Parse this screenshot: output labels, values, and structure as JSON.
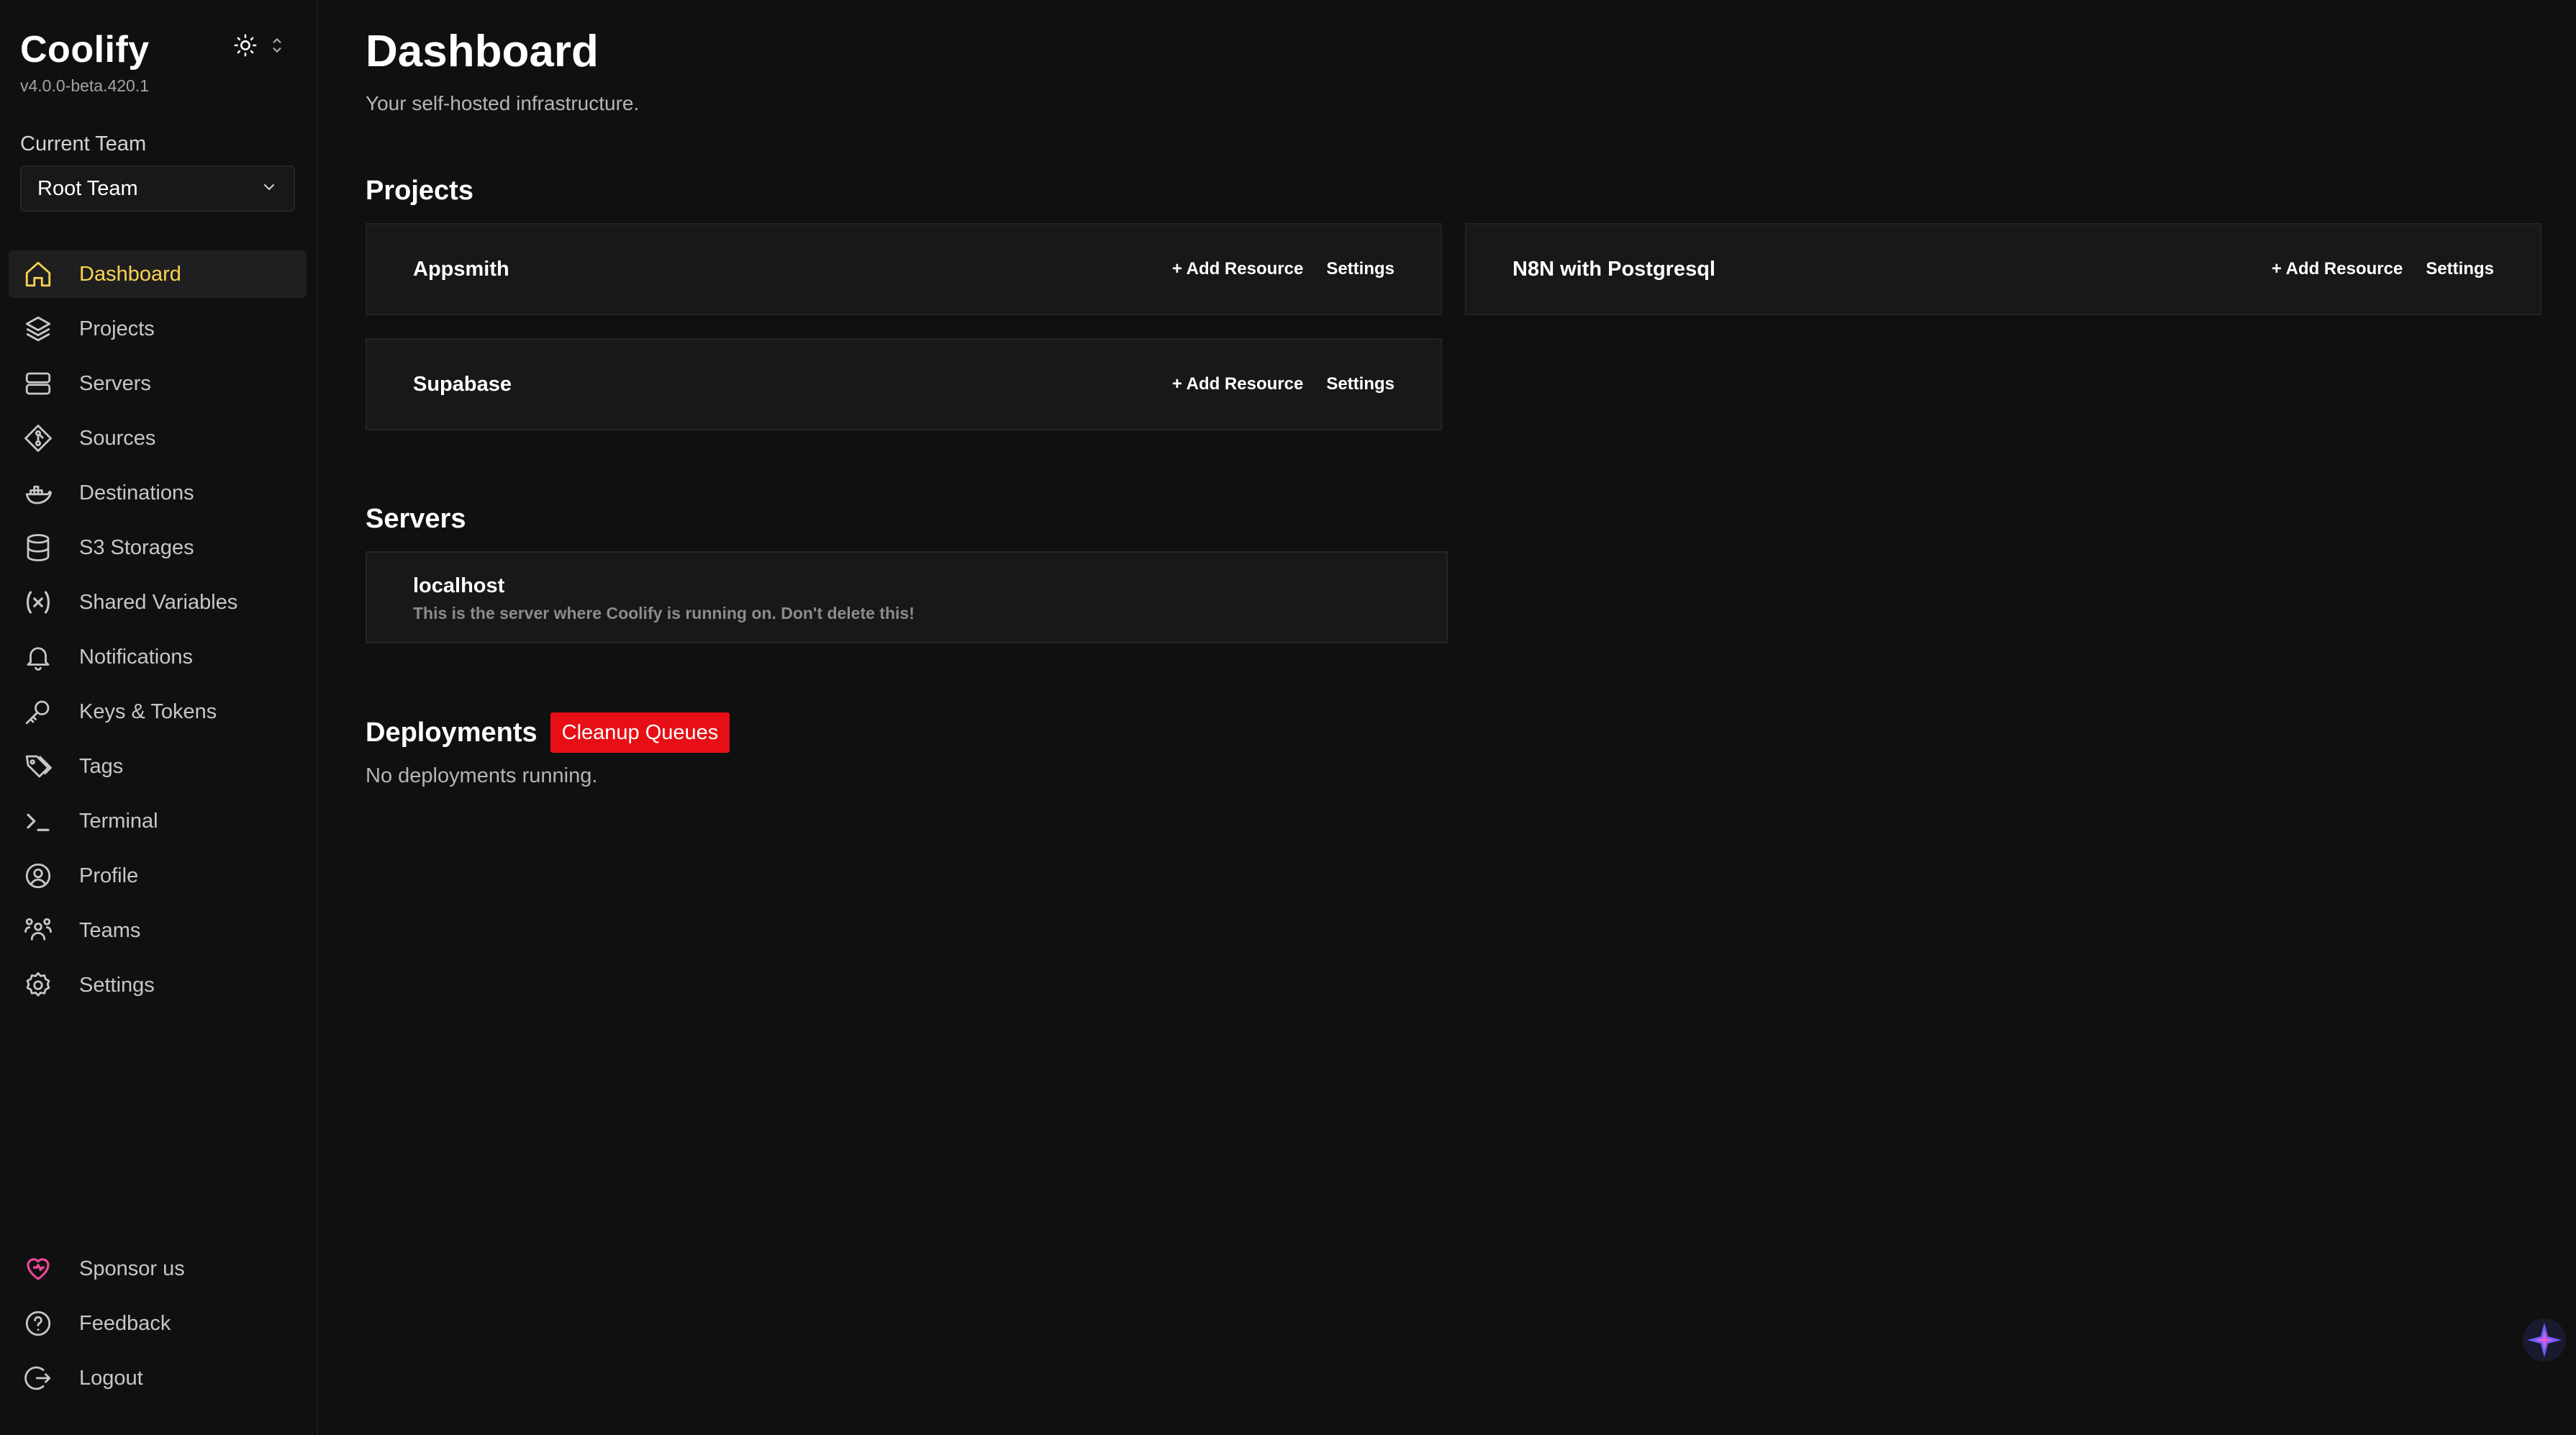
{
  "sidebar": {
    "brand": {
      "title": "Coolify",
      "version": "v4.0.0-beta.420.1"
    },
    "team": {
      "label": "Current Team",
      "selected": "Root Team"
    },
    "nav": [
      {
        "label": "Dashboard",
        "icon": "home-icon",
        "active": true
      },
      {
        "label": "Projects",
        "icon": "layers-icon"
      },
      {
        "label": "Servers",
        "icon": "server-icon"
      },
      {
        "label": "Sources",
        "icon": "git-icon"
      },
      {
        "label": "Destinations",
        "icon": "docker-icon"
      },
      {
        "label": "S3 Storages",
        "icon": "database-icon"
      },
      {
        "label": "Shared Variables",
        "icon": "variable-icon"
      },
      {
        "label": "Notifications",
        "icon": "bell-icon"
      },
      {
        "label": "Keys & Tokens",
        "icon": "key-icon"
      },
      {
        "label": "Tags",
        "icon": "tags-icon"
      },
      {
        "label": "Terminal",
        "icon": "terminal-icon"
      },
      {
        "label": "Profile",
        "icon": "user-circle-icon"
      },
      {
        "label": "Teams",
        "icon": "users-icon"
      },
      {
        "label": "Settings",
        "icon": "gear-icon"
      }
    ],
    "bottom": [
      {
        "label": "Sponsor us",
        "icon": "heart-icon"
      },
      {
        "label": "Feedback",
        "icon": "question-icon"
      },
      {
        "label": "Logout",
        "icon": "logout-icon"
      }
    ]
  },
  "main": {
    "title": "Dashboard",
    "subtitle": "Your self-hosted infrastructure.",
    "projects_title": "Projects",
    "projects": [
      {
        "name": "Appsmith",
        "add": "+ Add Resource",
        "settings": "Settings"
      },
      {
        "name": "N8N with Postgresql",
        "add": "+ Add Resource",
        "settings": "Settings"
      },
      {
        "name": "Supabase",
        "add": "+ Add Resource",
        "settings": "Settings"
      }
    ],
    "servers_title": "Servers",
    "servers": [
      {
        "name": "localhost",
        "description": "This is the server where Coolify is running on. Don't delete this!"
      }
    ],
    "deployments_title": "Deployments",
    "cleanup_label": "Cleanup Queues",
    "no_deployments": "No deployments running."
  },
  "colors": {
    "accent": "#fcd452",
    "danger": "#e70f15",
    "background": "#101010",
    "card": "#181818"
  }
}
